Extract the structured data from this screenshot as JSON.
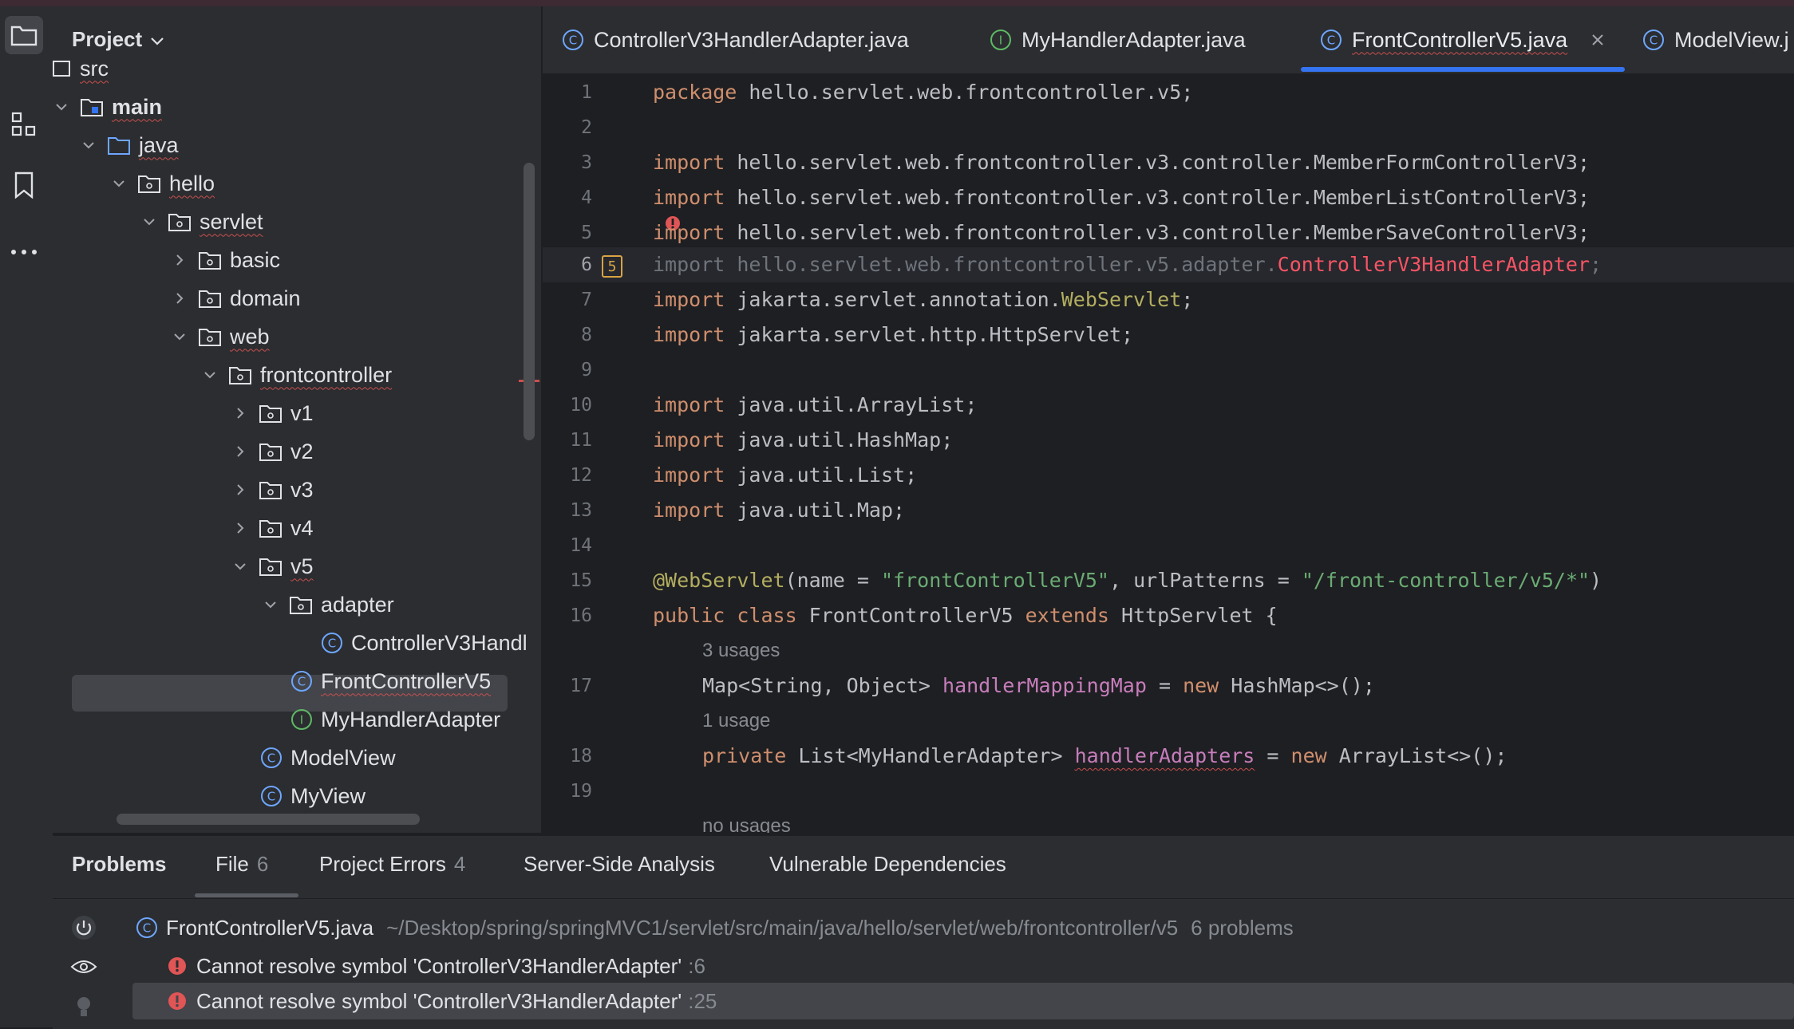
{
  "project_panel": {
    "title": "Project",
    "tree": [
      {
        "label": "src"
      },
      {
        "label": "main"
      },
      {
        "label": "java"
      },
      {
        "label": "hello"
      },
      {
        "label": "servlet"
      },
      {
        "label": "basic"
      },
      {
        "label": "domain"
      },
      {
        "label": "web"
      },
      {
        "label": "frontcontroller"
      },
      {
        "label": "v1"
      },
      {
        "label": "v2"
      },
      {
        "label": "v3"
      },
      {
        "label": "v4"
      },
      {
        "label": "v5"
      },
      {
        "label": "adapter"
      },
      {
        "label": "ControllerV3Handl"
      },
      {
        "label": "FrontControllerV5"
      },
      {
        "label": "MyHandlerAdapter"
      },
      {
        "label": "ModelView"
      },
      {
        "label": "MyView"
      }
    ]
  },
  "tabs": [
    {
      "label": "ControllerV3HandlerAdapter.java",
      "icon": "class-icon"
    },
    {
      "label": "MyHandlerAdapter.java",
      "icon": "interface-icon"
    },
    {
      "label": "FrontControllerV5.java",
      "icon": "class-icon",
      "active": true
    },
    {
      "label": "ModelView.j",
      "icon": "class-icon"
    }
  ],
  "editor": {
    "current_line": "6",
    "warning_badge": "5",
    "line_numbers": [
      "1",
      "2",
      "3",
      "4",
      "5",
      "6",
      "7",
      "8",
      "9",
      "10",
      "11",
      "12",
      "13",
      "14",
      "15",
      "16",
      "17",
      "18",
      "19"
    ],
    "code": {
      "l1_kw": "package",
      "l1_rest": " hello.servlet.web.frontcontroller.v5;",
      "import_kw": "import",
      "l3_rest": " hello.servlet.web.frontcontroller.v3.controller.MemberFormControllerV3;",
      "l4_rest": " hello.servlet.web.frontcontroller.v3.controller.MemberListControllerV3;",
      "l5_rest": " hello.servlet.web.frontcontroller.v3.controller.MemberSaveControllerV3;",
      "l6_a": "import hello.servlet.web.frontcontroller.v5.adapter.",
      "l6_b": "ControllerV3HandlerAdapter",
      "l6_c": ";",
      "l7_a": " jakarta.servlet.annotation.",
      "l7_b": "WebServlet",
      "l7_c": ";",
      "l8_rest": " jakarta.servlet.http.HttpServlet;",
      "l10_rest": " java.util.ArrayList;",
      "l11_rest": " java.util.HashMap;",
      "l12_rest": " java.util.List;",
      "l13_rest": " java.util.Map;",
      "l15_ann": "@WebServlet",
      "l15_a": "(name = ",
      "l15_s1": "\"frontControllerV5\"",
      "l15_b": ", urlPatterns = ",
      "l15_s2": "\"/front-controller/v5/*\"",
      "l15_c": ")",
      "l16_kw1": "public class",
      "l16_a": " FrontControllerV5 ",
      "l16_kw2": "extends",
      "l16_b": " HttpServlet {",
      "hint1": "3 usages",
      "l17_a": "Map<String, Object> ",
      "l17_fld": "handlerMappingMap",
      "l17_b": " = ",
      "l17_kw": "new",
      "l17_c": " HashMap<>();",
      "hint2": "1 usage",
      "l18_kw": "private",
      "l18_a": " List<MyHandlerAdapter> ",
      "l18_fld": "handlerAdapters",
      "l18_b": " = ",
      "l18_kw2": "new",
      "l18_c": " ArrayList<>();",
      "hint3": "no usages"
    }
  },
  "problems": {
    "tabs": [
      {
        "label": "Problems"
      },
      {
        "label": "File",
        "count": "6"
      },
      {
        "label": "Project Errors",
        "count": "4"
      },
      {
        "label": "Server-Side Analysis"
      },
      {
        "label": "Vulnerable Dependencies"
      }
    ],
    "file": {
      "name": "FrontControllerV5.java",
      "path": "~/Desktop/spring/springMVC1/servlet/src/main/java/hello/servlet/web/frontcontroller/v5",
      "count": "6 problems"
    },
    "items": [
      {
        "message": "Cannot resolve symbol 'ControllerV3HandlerAdapter'",
        "line": ":6"
      },
      {
        "message": "Cannot resolve symbol 'ControllerV3HandlerAdapter'",
        "line": ":25"
      }
    ]
  },
  "colors": {
    "accent": "#3574f0",
    "error": "#f75464",
    "keyword": "#cf8e6d",
    "string": "#6aab73"
  }
}
